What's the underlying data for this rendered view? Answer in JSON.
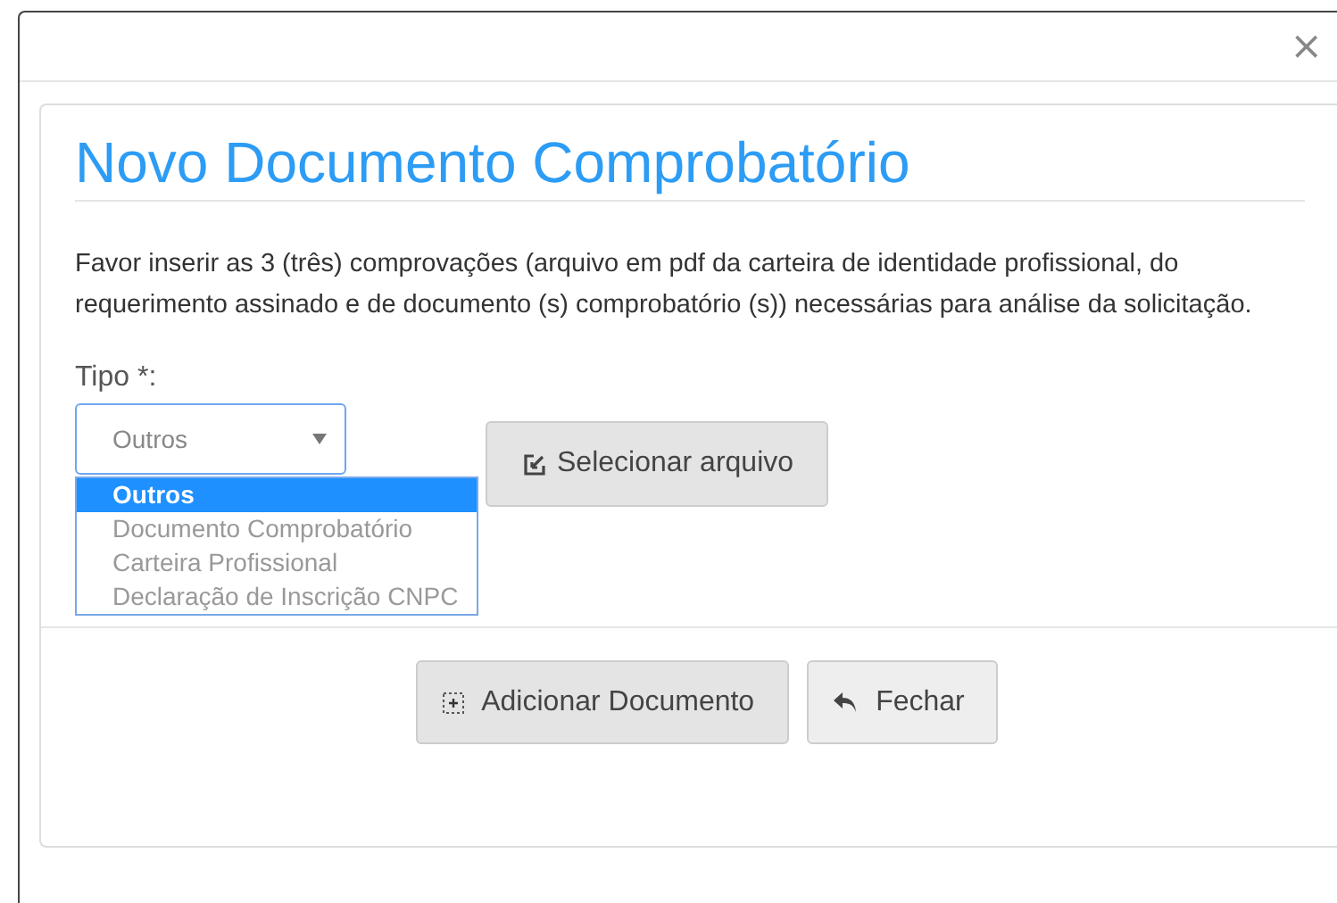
{
  "dialog": {
    "close": "×",
    "title": "Novo Documento Comprobatório",
    "description": "Favor inserir as 3 (três) comprovações (arquivo em pdf da carteira de identidade profissional, do requerimento assinado e de documento (s) comprobatório (s)) necessárias para análise da solicitação.",
    "type_field": {
      "label": "Tipo *:",
      "value": "Outros",
      "expanded": true,
      "options": [
        {
          "label": "Outros",
          "selected": true
        },
        {
          "label": "Documento Comprobatório",
          "selected": false
        },
        {
          "label": "Carteira Profissional",
          "selected": false
        },
        {
          "label": "Declaração de Inscrição CNPC",
          "selected": false
        }
      ]
    },
    "file_button": "Selecionar arquivo",
    "buttons": [
      {
        "kind": "add",
        "label": "Adicionar Documento"
      },
      {
        "kind": "close",
        "label": "Fechar"
      }
    ]
  }
}
